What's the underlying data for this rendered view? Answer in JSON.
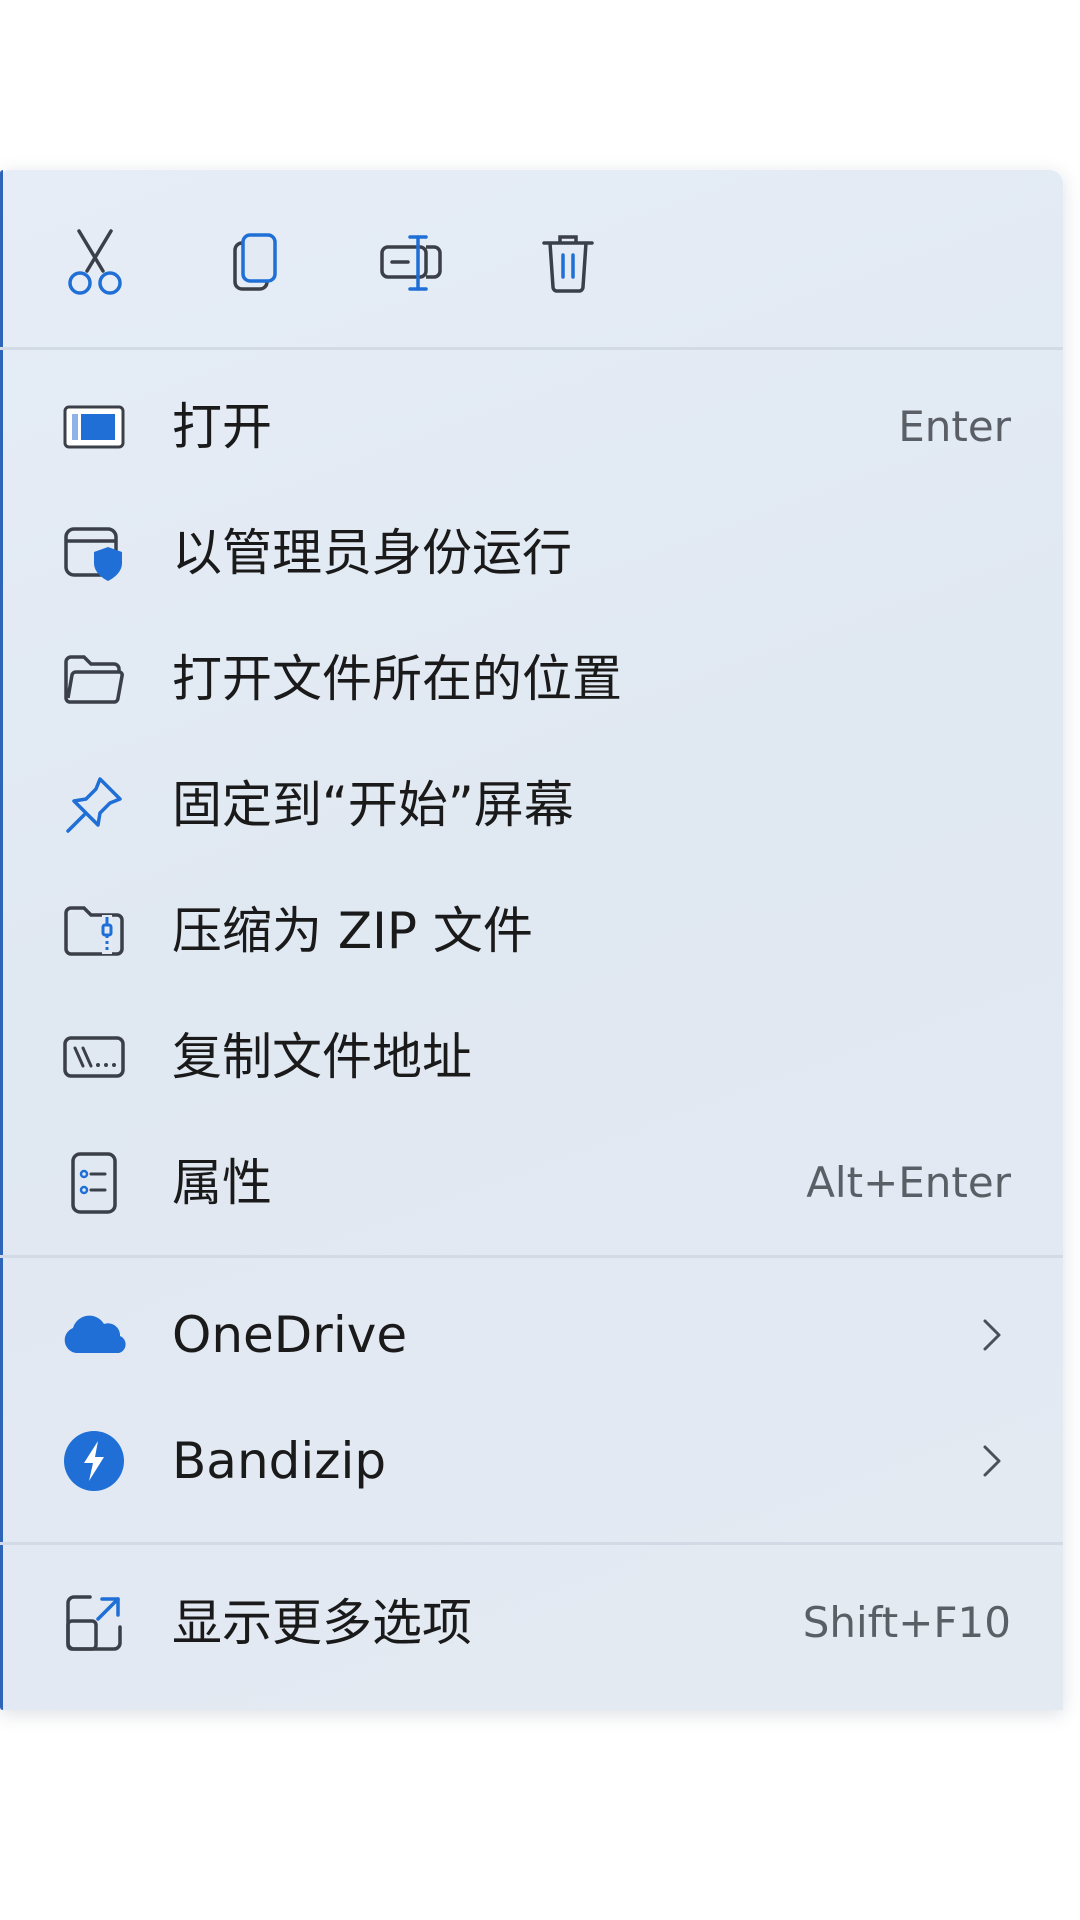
{
  "menu": {
    "toolbar": [
      {
        "icon": "scissors-icon",
        "label": "Cut"
      },
      {
        "icon": "copy-icon",
        "label": "Copy"
      },
      {
        "icon": "rename-icon",
        "label": "Rename"
      },
      {
        "icon": "trash-icon",
        "label": "Delete"
      }
    ],
    "items": [
      {
        "icon": "window-icon",
        "label": "打开",
        "shortcut": "Enter"
      },
      {
        "icon": "admin-shield-icon",
        "label": "以管理员身份运行",
        "shortcut": ""
      },
      {
        "icon": "folder-icon",
        "label": "打开文件所在的位置",
        "shortcut": ""
      },
      {
        "icon": "pin-icon",
        "label": "固定到“开始”屏幕",
        "shortcut": ""
      },
      {
        "icon": "zip-folder-icon",
        "label": "压缩为 ZIP 文件",
        "shortcut": ""
      },
      {
        "icon": "path-icon",
        "label": "复制文件地址",
        "shortcut": ""
      },
      {
        "icon": "properties-icon",
        "label": "属性",
        "shortcut": "Alt+Enter"
      },
      {
        "icon": "onedrive-cloud-icon",
        "label": "OneDrive",
        "shortcut": "",
        "submenu": true
      },
      {
        "icon": "bandizip-icon",
        "label": "Bandizip",
        "shortcut": "",
        "submenu": true
      },
      {
        "icon": "more-options-icon",
        "label": "显示更多选项",
        "shortcut": "Shift+F10"
      }
    ]
  },
  "colors": {
    "menu_background": "#e3eaf3",
    "accent_blue": "#1f6fd6",
    "icon_stroke": "#3b4048",
    "text": "#1a1a1a",
    "shortcut_text": "#5a5f66",
    "divider": "#d2dae5"
  }
}
